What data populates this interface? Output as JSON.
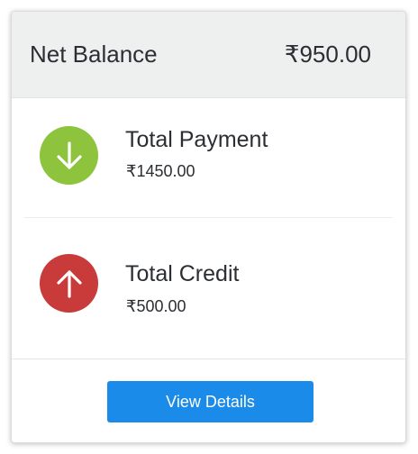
{
  "header": {
    "label": "Net Balance",
    "amount": "₹950.00",
    "background": "#eef0f0"
  },
  "rows": [
    {
      "title": "Total Payment",
      "amount": "₹1450.00",
      "icon": "arrow-down-icon",
      "icon_color": "#8dc33d"
    },
    {
      "title": "Total Credit",
      "amount": "₹500.00",
      "icon": "arrow-up-icon",
      "icon_color": "#c93a3a"
    }
  ],
  "footer": {
    "button_label": "View Details",
    "button_color": "#1a8be8"
  }
}
